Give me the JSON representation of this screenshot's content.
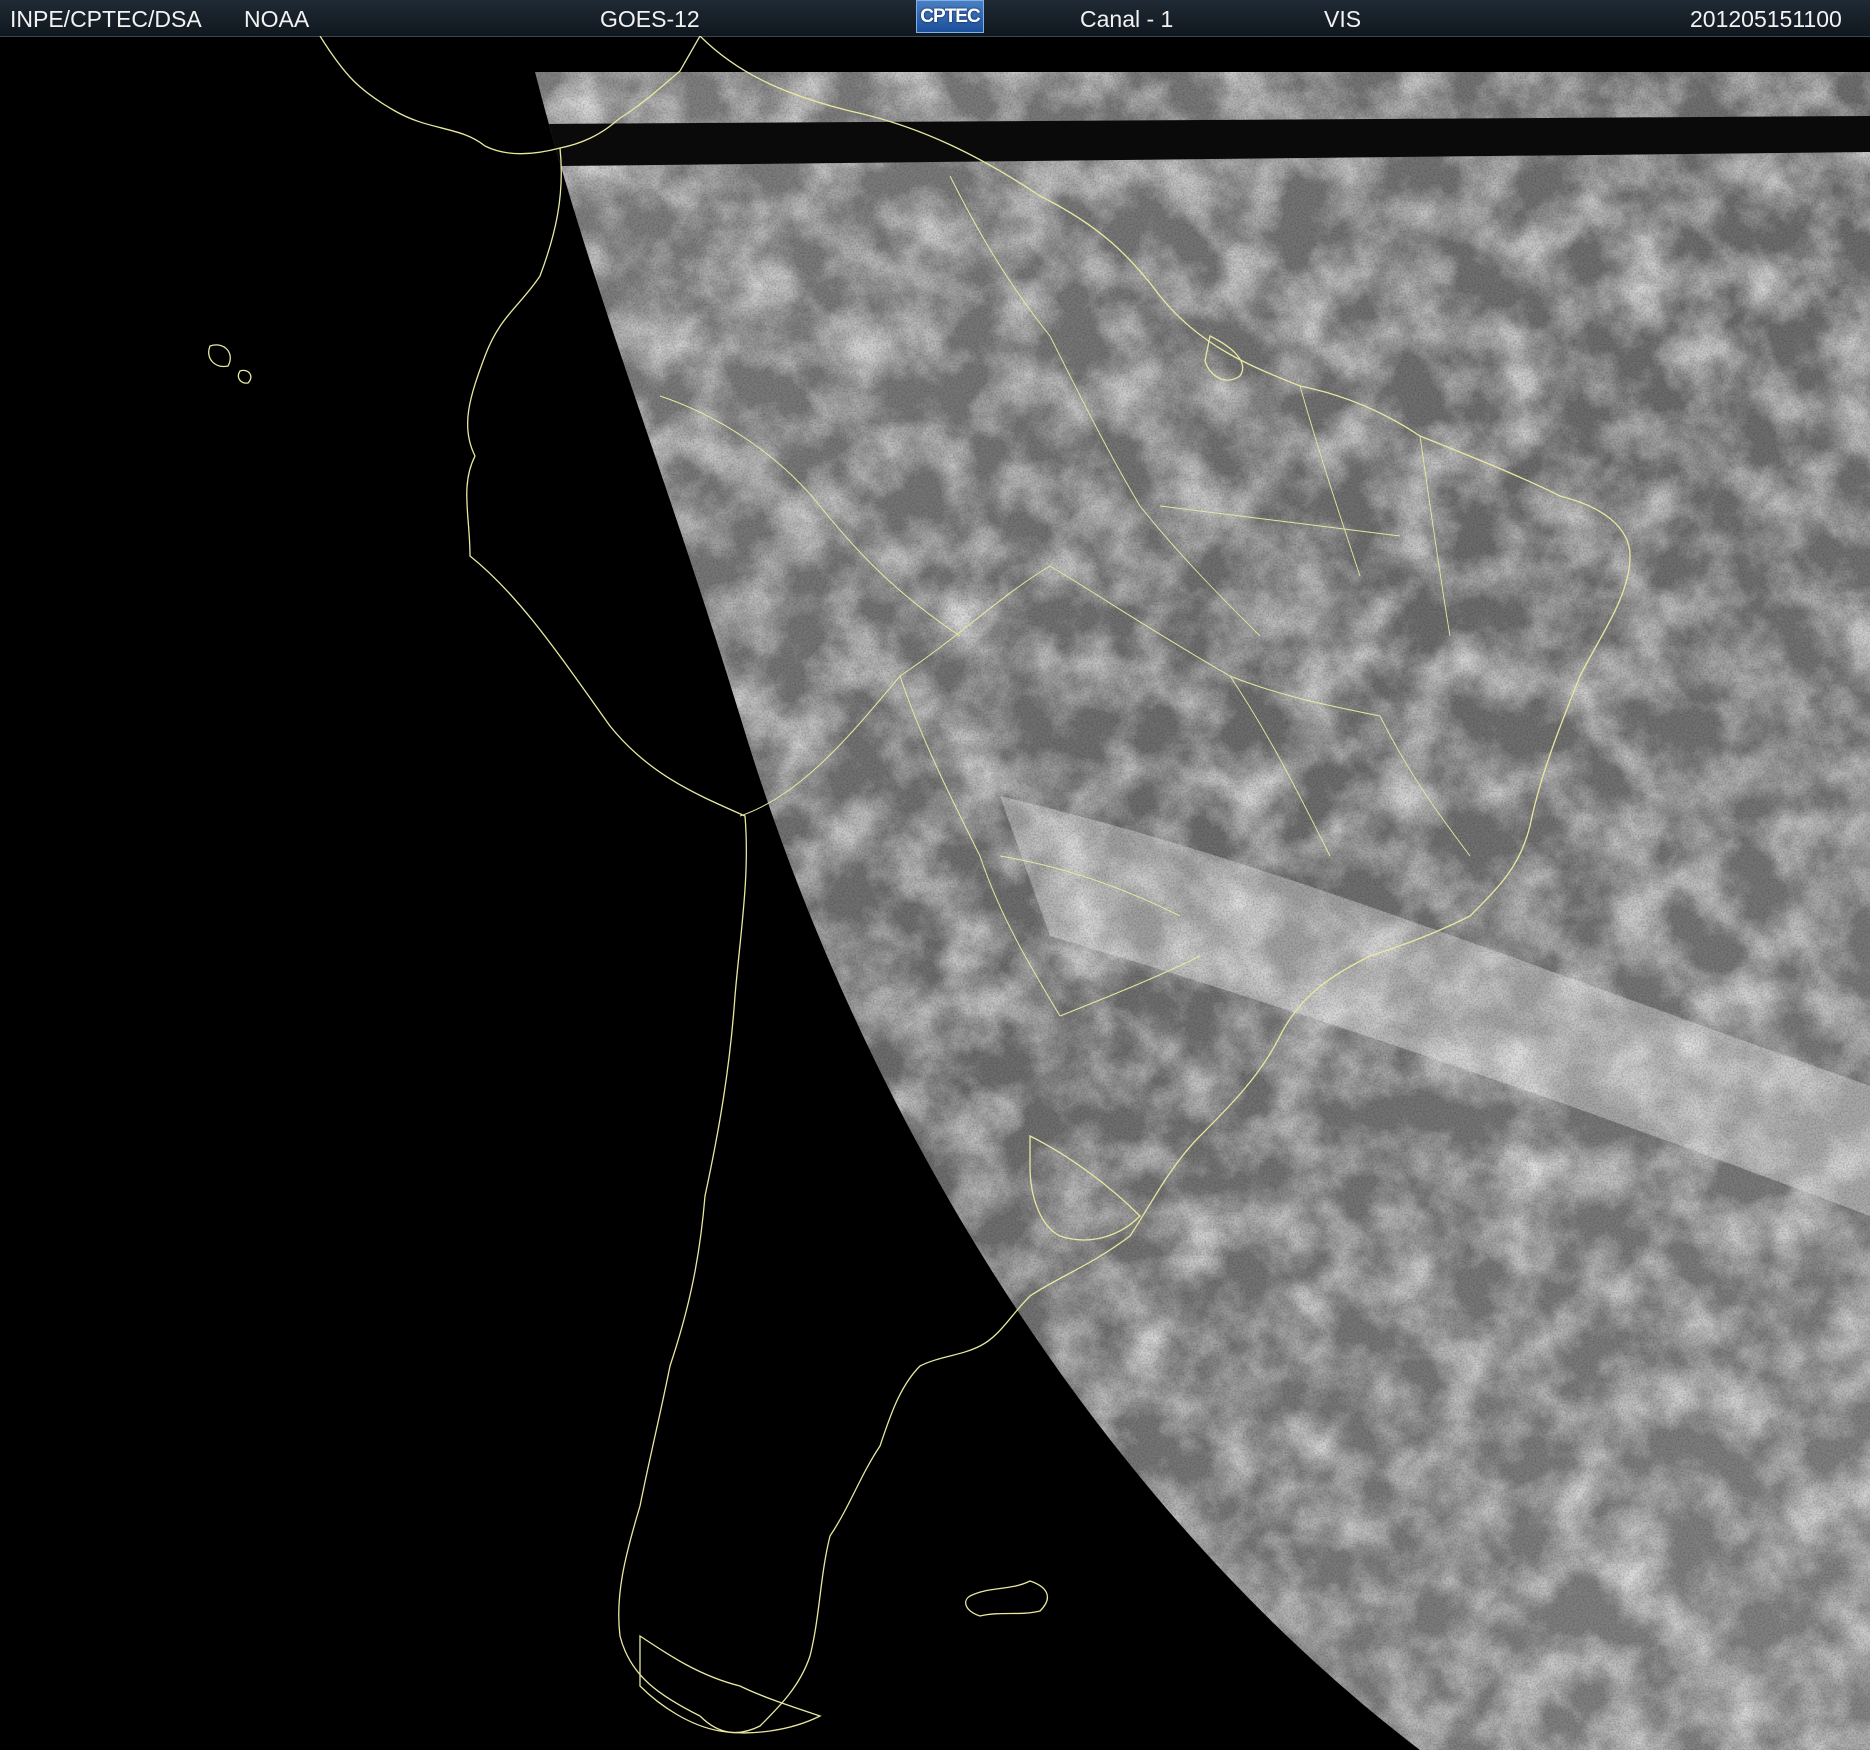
{
  "header": {
    "institution": "INPE/CPTEC/DSA",
    "agency": "NOAA",
    "satellite": "GOES-12",
    "logo_text": "CPTEC",
    "channel": "Canal - 1",
    "band": "VIS",
    "timestamp": "201205151100"
  },
  "map": {
    "type": "satellite-visible-image",
    "region": "South America",
    "coastline_color": "#e8e8a0",
    "background_color": "#000000",
    "cloud_gray_color": "#7a7a7a"
  }
}
